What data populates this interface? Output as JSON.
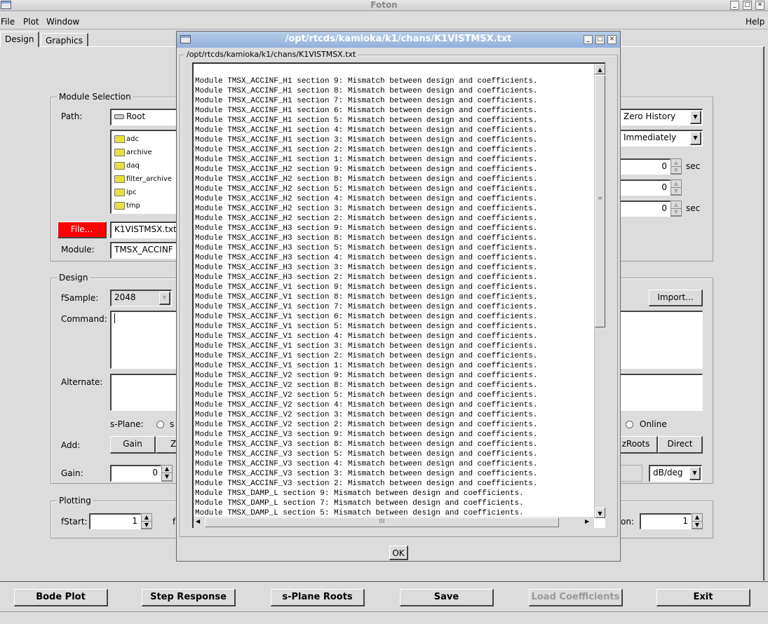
{
  "window": {
    "title": "Foton"
  },
  "menu": {
    "file": "File",
    "plot": "Plot",
    "window": "Window",
    "help": "Help"
  },
  "tabs": [
    {
      "label": "Design",
      "active": true
    },
    {
      "label": "Graphics",
      "active": false
    }
  ],
  "module_selection": {
    "legend": "Module Selection",
    "path_label": "Path:",
    "path_value": "Root",
    "folders": [
      "adc",
      "archive",
      "daq",
      "filter_archive",
      "ipc",
      "tmp"
    ],
    "file_button": "File...",
    "file_value": "K1VISTMSX.txt",
    "module_label": "Module:",
    "module_value": "TMSX_ACCINF",
    "history_value": "Zero History",
    "timing_value": "Immediately",
    "spin1_value": "0",
    "spin1_unit": "sec",
    "spin2_value": "0",
    "spin3_value": "0",
    "spin3_unit": "sec"
  },
  "design": {
    "legend": "Design",
    "fsample_label": "fSample:",
    "fsample_value": "2048",
    "import_button": "Import...",
    "command_label": "Command:",
    "command_value": "",
    "alternate_label": "Alternate:",
    "splane_label": "s-Plane:",
    "splane_option_s": "s",
    "splane_option_online": "Online",
    "add_label": "Add:",
    "add_gain": "Gain",
    "add_z": "Z",
    "add_zroots": "zRoots",
    "add_direct": "Direct",
    "gain_label": "Gain:",
    "gain_value": "0",
    "units_value": "dB/deg"
  },
  "plotting": {
    "legend": "Plotting",
    "fstart_label": "fStart:",
    "fstart_value": "1",
    "fstop_label_partial": "f",
    "right_label_partial": "on:",
    "right_value": "1"
  },
  "bottom_buttons": {
    "bode": "Bode Plot",
    "step": "Step Response",
    "splane": "s-Plane Roots",
    "save": "Save",
    "load": "Load Coefficients",
    "exit": "Exit"
  },
  "dialog": {
    "title": "/opt/rtcds/kamioka/k1/chans/K1VISTMSX.txt",
    "group_label": "/opt/rtcds/kamioka/k1/chans/K1VISTMSX.txt",
    "ok_button": "OK",
    "lines": [
      "Module TMSX_ACCINF_H1 section 9: Mismatch between design and coefficients.",
      "Module TMSX_ACCINF_H1 section 8: Mismatch between design and coefficients.",
      "Module TMSX_ACCINF_H1 section 7: Mismatch between design and coefficients.",
      "Module TMSX_ACCINF_H1 section 6: Mismatch between design and coefficients.",
      "Module TMSX_ACCINF_H1 section 5: Mismatch between design and coefficients.",
      "Module TMSX_ACCINF_H1 section 4: Mismatch between design and coefficients.",
      "Module TMSX_ACCINF_H1 section 3: Mismatch between design and coefficients.",
      "Module TMSX_ACCINF_H1 section 2: Mismatch between design and coefficients.",
      "Module TMSX_ACCINF_H1 section 1: Mismatch between design and coefficients.",
      "Module TMSX_ACCINF_H2 section 9: Mismatch between design and coefficients.",
      "Module TMSX_ACCINF_H2 section 8: Mismatch between design and coefficients.",
      "Module TMSX_ACCINF_H2 section 5: Mismatch between design and coefficients.",
      "Module TMSX_ACCINF_H2 section 4: Mismatch between design and coefficients.",
      "Module TMSX_ACCINF_H2 section 3: Mismatch between design and coefficients.",
      "Module TMSX_ACCINF_H2 section 2: Mismatch between design and coefficients.",
      "Module TMSX_ACCINF_H3 section 9: Mismatch between design and coefficients.",
      "Module TMSX_ACCINF_H3 section 8: Mismatch between design and coefficients.",
      "Module TMSX_ACCINF_H3 section 5: Mismatch between design and coefficients.",
      "Module TMSX_ACCINF_H3 section 4: Mismatch between design and coefficients.",
      "Module TMSX_ACCINF_H3 section 3: Mismatch between design and coefficients.",
      "Module TMSX_ACCINF_H3 section 2: Mismatch between design and coefficients.",
      "Module TMSX_ACCINF_V1 section 9: Mismatch between design and coefficients.",
      "Module TMSX_ACCINF_V1 section 8: Mismatch between design and coefficients.",
      "Module TMSX_ACCINF_V1 section 7: Mismatch between design and coefficients.",
      "Module TMSX_ACCINF_V1 section 6: Mismatch between design and coefficients.",
      "Module TMSX_ACCINF_V1 section 5: Mismatch between design and coefficients.",
      "Module TMSX_ACCINF_V1 section 4: Mismatch between design and coefficients.",
      "Module TMSX_ACCINF_V1 section 3: Mismatch between design and coefficients.",
      "Module TMSX_ACCINF_V1 section 2: Mismatch between design and coefficients.",
      "Module TMSX_ACCINF_V1 section 1: Mismatch between design and coefficients.",
      "Module TMSX_ACCINF_V2 section 9: Mismatch between design and coefficients.",
      "Module TMSX_ACCINF_V2 section 8: Mismatch between design and coefficients.",
      "Module TMSX_ACCINF_V2 section 5: Mismatch between design and coefficients.",
      "Module TMSX_ACCINF_V2 section 4: Mismatch between design and coefficients.",
      "Module TMSX_ACCINF_V2 section 3: Mismatch between design and coefficients.",
      "Module TMSX_ACCINF_V2 section 2: Mismatch between design and coefficients.",
      "Module TMSX_ACCINF_V3 section 9: Mismatch between design and coefficients.",
      "Module TMSX_ACCINF_V3 section 8: Mismatch between design and coefficients.",
      "Module TMSX_ACCINF_V3 section 5: Mismatch between design and coefficients.",
      "Module TMSX_ACCINF_V3 section 4: Mismatch between design and coefficients.",
      "Module TMSX_ACCINF_V3 section 3: Mismatch between design and coefficients.",
      "Module TMSX_ACCINF_V3 section 2: Mismatch between design and coefficients.",
      "Module TMSX_DAMP_L section 9: Mismatch between design and coefficients.",
      "Module TMSX_DAMP_L section 7: Mismatch between design and coefficients.",
      "Module TMSX_DAMP_L section 5: Mismatch between design and coefficients."
    ]
  },
  "colors": {
    "file_button": "#ff0000",
    "dialog_title": "#9ab6de",
    "folder": "#e6e040"
  }
}
